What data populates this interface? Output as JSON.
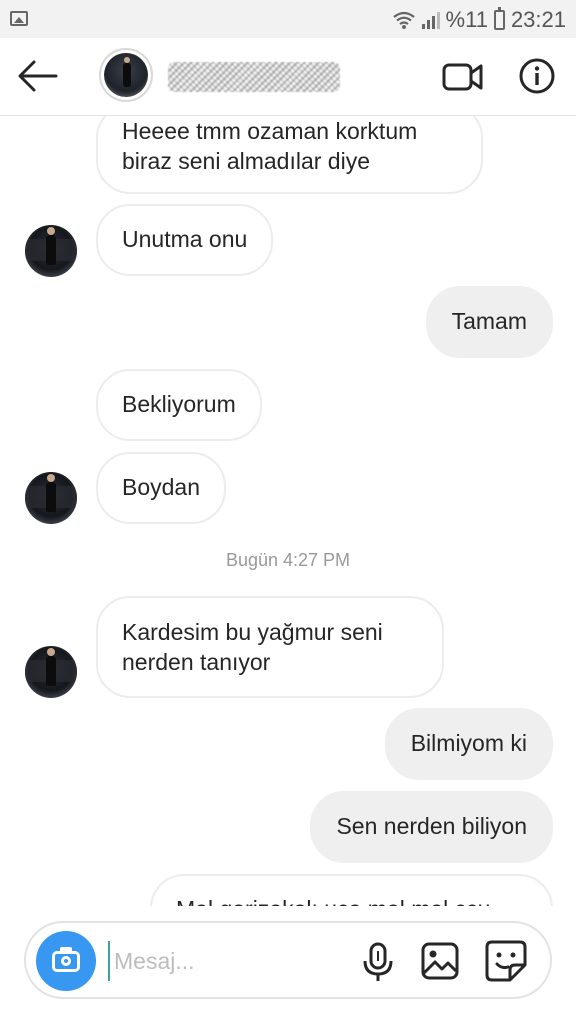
{
  "status_bar": {
    "battery_text": "%11",
    "time": "23:21",
    "icons": [
      "image-icon",
      "wifi-icon",
      "signal-icon",
      "battery-icon"
    ]
  },
  "header": {
    "icons": [
      "back-arrow-icon",
      "video-call-icon",
      "info-icon"
    ]
  },
  "messages": [
    {
      "text_line1": "Heeee tmm ozaman korktum",
      "text_line2": "biraz seni almadılar diye",
      "from": "them"
    },
    {
      "text": "Unutma onu",
      "from": "them"
    },
    {
      "text": "Tamam",
      "from": "me"
    },
    {
      "text": "Bekliyorum",
      "from": "them"
    },
    {
      "text": "Boydan",
      "from": "them"
    },
    {
      "text_line1": "Kardesim bu yağmur seni",
      "text_line2": "nerden tanıyor",
      "from": "them"
    },
    {
      "text": "Bilmiyom ki",
      "from": "me"
    },
    {
      "text": "Sen nerden biliyon",
      "from": "me"
    },
    {
      "text": "Mal gerizekalı uca mal mal ccu",
      "from": "them"
    }
  ],
  "timestamp": "Bugün 4:27 PM",
  "composer": {
    "placeholder": "Mesaj...",
    "icons": [
      "camera-icon",
      "microphone-icon",
      "gallery-icon",
      "sticker-icon"
    ],
    "accent_color": "#3897f0"
  },
  "colors": {
    "my_bubble": "#efefef",
    "their_bubble_border": "#ececec",
    "text": "#262626"
  }
}
